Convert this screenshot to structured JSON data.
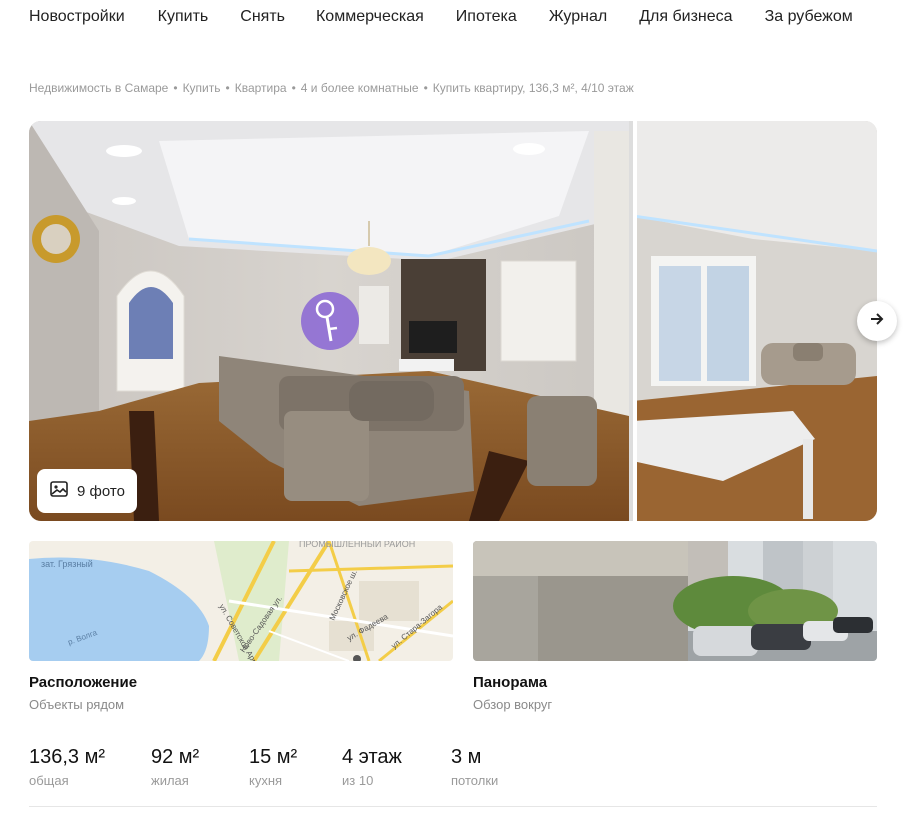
{
  "nav": {
    "items": [
      "Новостройки",
      "Купить",
      "Снять",
      "Коммерческая",
      "Ипотека",
      "Журнал",
      "Для бизнеса",
      "За рубежом"
    ]
  },
  "breadcrumb": [
    "Недвижимость в Самаре",
    "Купить",
    "Квартира",
    "4 и более комнатные",
    "Купить квартиру, 136,3 м², 4/10 этаж"
  ],
  "gallery": {
    "photo_count": "9 фото"
  },
  "location_card": {
    "title": "Расположение",
    "subtitle": "Объекты рядом",
    "map_labels": {
      "district": "ПРОМЫШЛЕННЫЙ РАЙОН",
      "bay": "зат. Грязный",
      "river": "р. Волга",
      "street1": "ул. Советской Армии",
      "street2": "Ново-Садовая ул.",
      "street3": "Московское ш.",
      "street4": "ул. Фадеева",
      "street5": "ул. Стара-Загора"
    }
  },
  "panorama_card": {
    "title": "Панорама",
    "subtitle": "Обзор вокруг"
  },
  "params": [
    {
      "value": "136,3 м²",
      "label": "общая"
    },
    {
      "value": "92 м²",
      "label": "жилая"
    },
    {
      "value": "15 м²",
      "label": "кухня"
    },
    {
      "value": "4 этаж",
      "label": "из 10"
    },
    {
      "value": "3 м",
      "label": "потолки"
    }
  ],
  "colors": {
    "accent_badge": "#7b52d6",
    "text_muted": "#9a9a9a"
  }
}
